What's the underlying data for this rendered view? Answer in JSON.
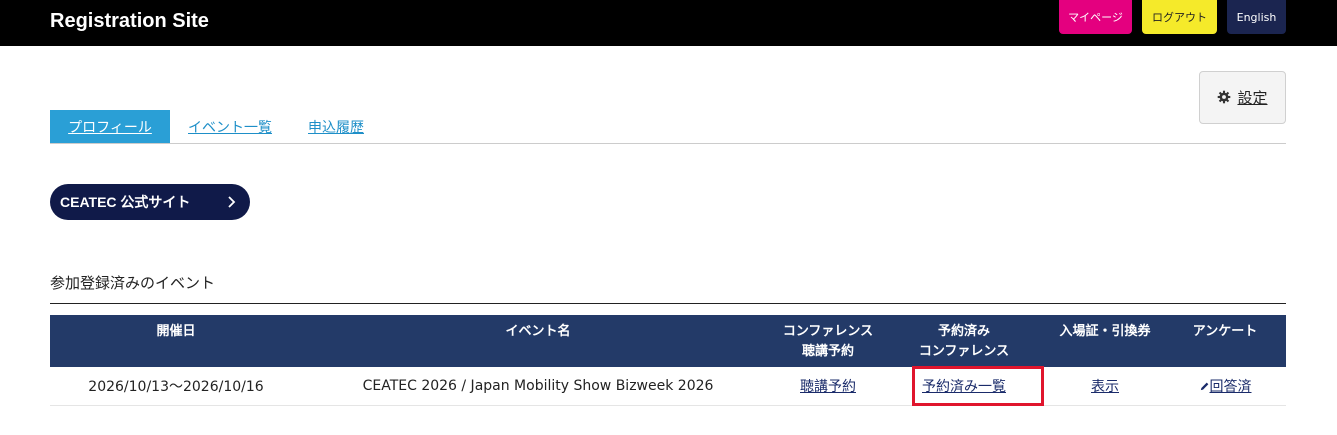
{
  "header": {
    "brand": "Registration Site",
    "mypage_label": "マイページ",
    "logout_label": "ログアウト",
    "language_label": "English"
  },
  "settings": {
    "label": "設定",
    "icon": "gear-icon"
  },
  "tabs": [
    {
      "label": "プロフィール",
      "active": true
    },
    {
      "label": "イベント一覧",
      "active": false
    },
    {
      "label": "申込履歴",
      "active": false
    }
  ],
  "official_site": {
    "label": "CEATEC 公式サイト",
    "icon": "chevron-right-icon"
  },
  "registered_events": {
    "title": "参加登録済みのイベント",
    "columns": {
      "date": "開催日",
      "event_name": "イベント名",
      "conference_booking_1": "コンファレンス",
      "conference_booking_2": "聴講予約",
      "booked_conf_1": "予約済み",
      "booked_conf_2": "コンファレンス",
      "ticket": "入場証・引換券",
      "survey": "アンケート"
    },
    "rows": [
      {
        "date": "2026/10/13〜2026/10/16",
        "event_name": "CEATEC 2026 / Japan Mobility Show Bizweek 2026",
        "conference_booking": "聴講予約",
        "booked_conferences": "予約済み一覧",
        "ticket": "表示",
        "survey": "回答済"
      }
    ]
  },
  "colors": {
    "topbar": "#000000",
    "mypage": "#e4007f",
    "logout": "#f5ea2a",
    "english": "#1b2550",
    "tab_active": "#2a9fd6",
    "table_header": "#233a68",
    "official_button": "#101a49",
    "highlight": "#e0152d"
  }
}
